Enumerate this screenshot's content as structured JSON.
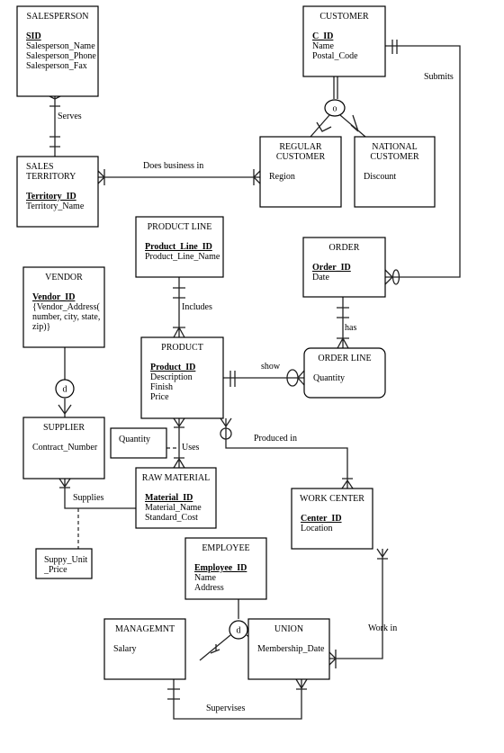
{
  "entities": {
    "salesperson": {
      "title": [
        "SALESPERSON"
      ],
      "key": "SID",
      "attributes": [
        "Salesperson_Name",
        "Salesperson_Phone",
        "Salesperson_Fax"
      ]
    },
    "customer": {
      "title": [
        "CUSTOMER"
      ],
      "key": "C_ID",
      "attributes": [
        "Name",
        "Postal_Code"
      ]
    },
    "sales_territory": {
      "title": [
        "SALES",
        "TERRITORY"
      ],
      "key": "Territory_ID",
      "attributes": [
        "Territory_Name"
      ]
    },
    "regular_customer": {
      "title": [
        "REGULAR",
        "CUSTOMER"
      ],
      "key": "",
      "attributes": [
        "Region"
      ]
    },
    "national_customer": {
      "title": [
        "NATIONAL",
        "CUSTOMER"
      ],
      "key": "",
      "attributes": [
        "Discount"
      ]
    },
    "product_line": {
      "title": [
        "PRODUCT LINE"
      ],
      "key": "Product_Line_ID",
      "attributes": [
        "Product_Line_Name"
      ]
    },
    "order": {
      "title": [
        "ORDER"
      ],
      "key": "Order_ID",
      "attributes": [
        "Date"
      ]
    },
    "vendor": {
      "title": [
        "VENDOR"
      ],
      "key": "Vendor_ID",
      "attributes": [
        "{Vendor_Address(",
        "number, city, state,",
        "zip)}"
      ]
    },
    "product": {
      "title": [
        "PRODUCT"
      ],
      "key": "Product_ID",
      "attributes": [
        "Description",
        "Finish",
        "Price"
      ]
    },
    "order_line": {
      "title": [
        "ORDER LINE"
      ],
      "key": "",
      "attributes": [
        "Quantity"
      ]
    },
    "supplier": {
      "title": [
        "SUPPLIER"
      ],
      "key": "",
      "attributes": [
        "Contract_Number"
      ]
    },
    "raw_material": {
      "title": [
        "RAW MATERIAL"
      ],
      "key": "Material_ID",
      "attributes": [
        "Material_Name",
        "Standard_Cost"
      ]
    },
    "work_center": {
      "title": [
        "WORK CENTER"
      ],
      "key": "Center_ID",
      "attributes": [
        "Location"
      ]
    },
    "employee": {
      "title": [
        "EMPLOYEE"
      ],
      "key": "Employee_ID",
      "attributes": [
        "Name",
        "Address"
      ]
    },
    "managemnt": {
      "title": [
        "MANAGEMNT"
      ],
      "key": "",
      "attributes": [
        "Salary"
      ]
    },
    "union": {
      "title": [
        "UNION"
      ],
      "key": "",
      "attributes": [
        "Membership_Date"
      ]
    }
  },
  "relationship_attributes": {
    "uses_quantity": "Quantity",
    "supplies_price": [
      "Suppy_Unit",
      "_Price"
    ]
  },
  "relationships": {
    "serves": "Serves",
    "does_business_in": "Does business in",
    "submits": "Submits",
    "includes": "Includes",
    "has": "has",
    "show": "show",
    "uses": "Uses",
    "produced_in": "Produced in",
    "supplies": "Supplies",
    "work_in": "Work  in",
    "supervises": "Supervises"
  },
  "subtype_symbols": {
    "customer": "o",
    "vendor": "d",
    "employee": "d"
  }
}
